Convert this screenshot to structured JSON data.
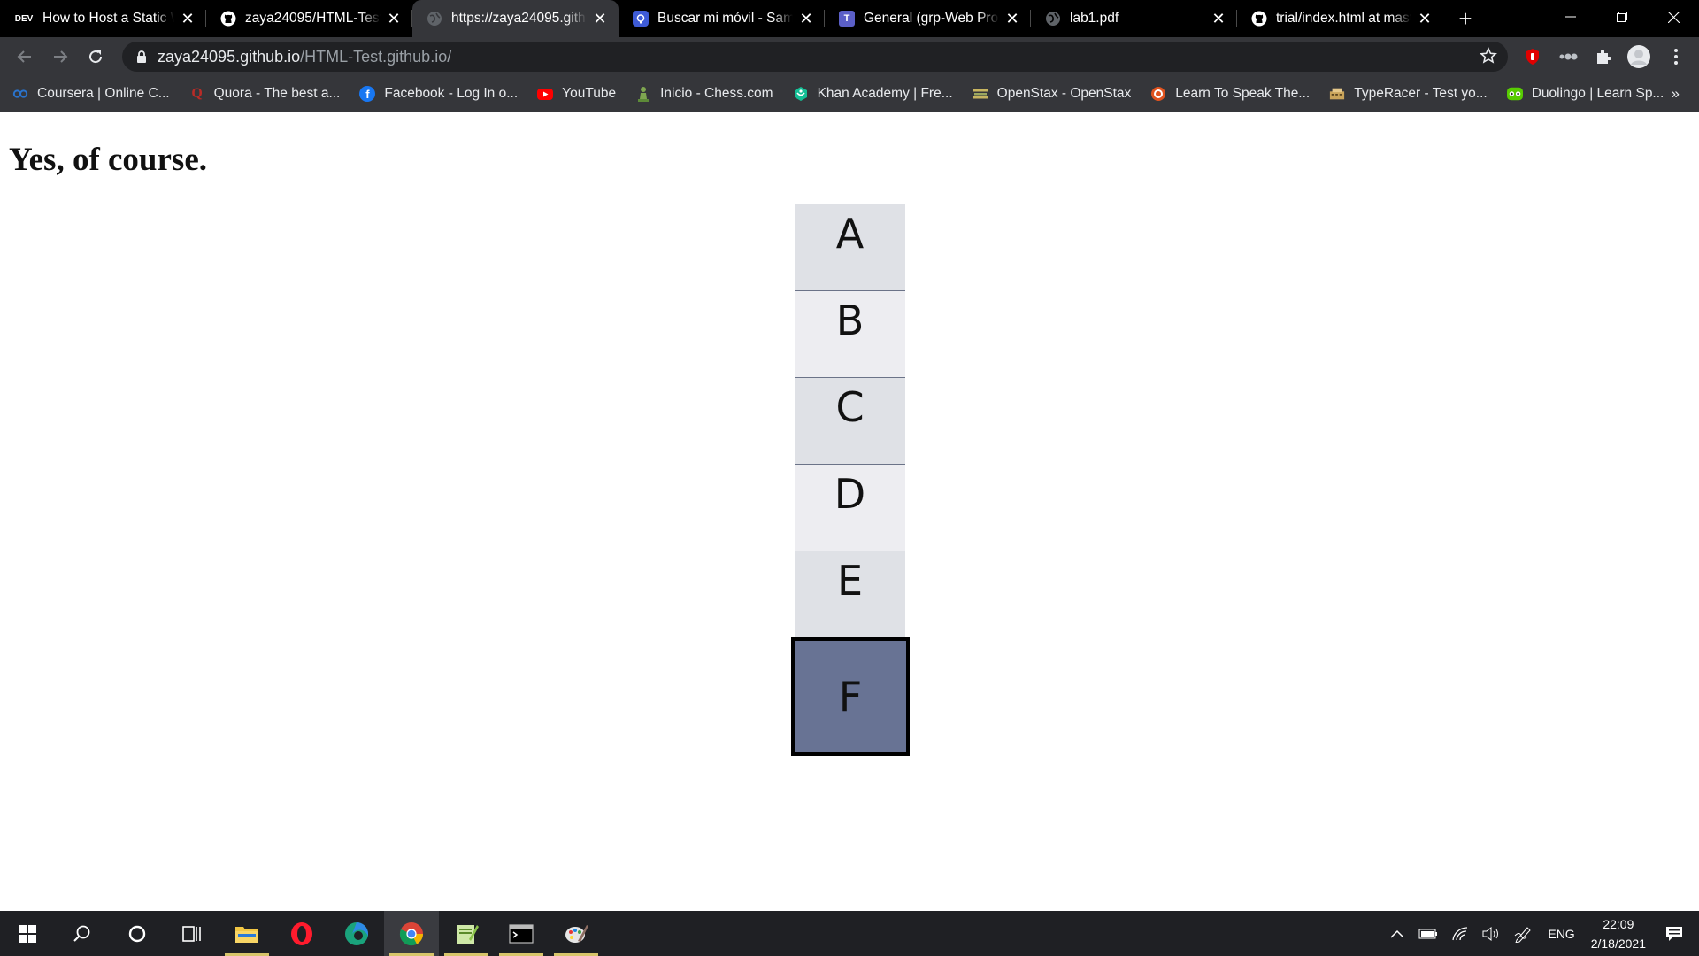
{
  "tabs": [
    {
      "title": "How to Host a Static W",
      "favicon": "dev-icon",
      "badge": "DEV"
    },
    {
      "title": "zaya24095/HTML-Test.gith",
      "favicon": "github-icon"
    },
    {
      "title": "https://zaya24095.github.io",
      "favicon": "globe-icon",
      "active": true
    },
    {
      "title": "Buscar mi móvil - Samsung",
      "favicon": "samsung-find-icon"
    },
    {
      "title": "General (grp-Web Prog",
      "favicon": "teams-icon"
    },
    {
      "title": "lab1.pdf",
      "favicon": "globe-icon"
    },
    {
      "title": "trial/index.html at master",
      "favicon": "github-icon"
    }
  ],
  "toolbar": {
    "url_host": "zaya24095.github.io",
    "url_path": "/HTML-Test.github.io/"
  },
  "bookmarks": [
    {
      "label": "Coursera | Online C...",
      "icon": "coursera-icon",
      "color": "#2a73cc"
    },
    {
      "label": "Quora - The best a...",
      "icon": "quora-icon",
      "color": "#b92b27"
    },
    {
      "label": "Facebook - Log In o...",
      "icon": "facebook-icon",
      "color": "#1877f2"
    },
    {
      "label": "YouTube",
      "icon": "youtube-icon",
      "color": "#ff0000"
    },
    {
      "label": "Inicio - Chess.com",
      "icon": "chess-icon",
      "color": "#7fa650"
    },
    {
      "label": "Khan Academy | Fre...",
      "icon": "khan-icon",
      "color": "#14bf96"
    },
    {
      "label": "OpenStax - OpenStax",
      "icon": "openstax-icon",
      "color": "#c8b560"
    },
    {
      "label": "Learn To Speak The...",
      "icon": "learn-speak-icon",
      "color": "#e0531f"
    },
    {
      "label": "TypeRacer - Test yo...",
      "icon": "typeracer-icon",
      "color": "#c9a45a"
    },
    {
      "label": "Duolingo | Learn Sp...",
      "icon": "duolingo-icon",
      "color": "#58cc02"
    }
  ],
  "bookmarks_more": "»",
  "page": {
    "heading": "Yes, of course.",
    "items": [
      "A",
      "B",
      "C",
      "D",
      "E",
      "F"
    ],
    "selected": "F"
  },
  "taskbar": {
    "time": "22:09",
    "date": "2/18/2021",
    "language": "ENG"
  }
}
